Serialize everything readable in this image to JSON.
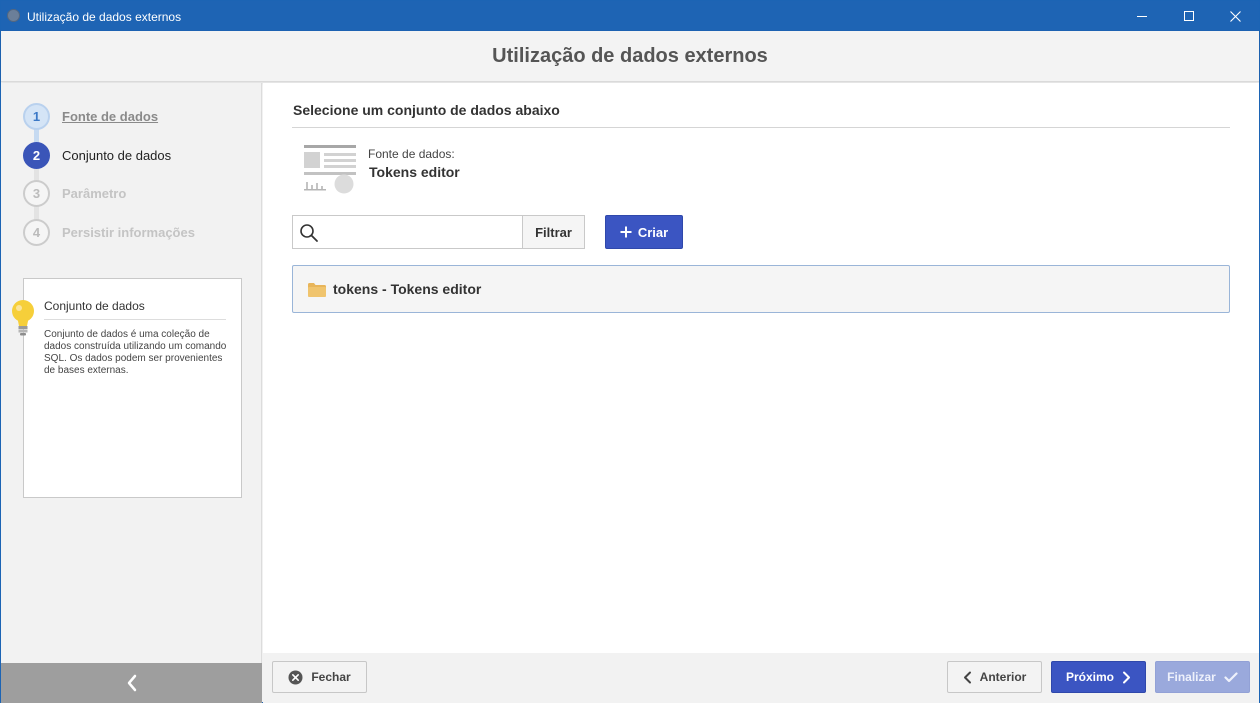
{
  "window": {
    "title": "Utilização de dados externos"
  },
  "header": {
    "title": "Utilização de dados externos"
  },
  "steps": [
    {
      "number": "1",
      "label": "Fonte de dados",
      "state": "done"
    },
    {
      "number": "2",
      "label": "Conjunto de dados",
      "state": "active"
    },
    {
      "number": "3",
      "label": "Parâmetro",
      "state": "pending"
    },
    {
      "number": "4",
      "label": "Persistir informações",
      "state": "pending"
    }
  ],
  "info": {
    "title": "Conjunto de dados",
    "text": "Conjunto de dados é uma coleção de dados construída utilizando um comando SQL. Os dados podem ser provenientes de bases externas.",
    "icon": "lightbulb-icon"
  },
  "main": {
    "section_title": "Selecione um conjunto de dados abaixo",
    "datasource_label": "Fonte de dados:",
    "datasource_value": "Tokens editor",
    "search": {
      "value": "",
      "placeholder": ""
    },
    "filter_label": "Filtrar",
    "create_label": "Criar",
    "items": [
      {
        "label": "tokens - Tokens editor",
        "icon": "folder-icon"
      }
    ]
  },
  "footer": {
    "close_label": "Fechar",
    "prev_label": "Anterior",
    "next_label": "Próximo",
    "finish_label": "Finalizar"
  },
  "colors": {
    "titlebar": "#1e64b4",
    "primary": "#3b55c2",
    "primary_disabled": "#9aa9dc",
    "folder": "#e8b55a"
  }
}
